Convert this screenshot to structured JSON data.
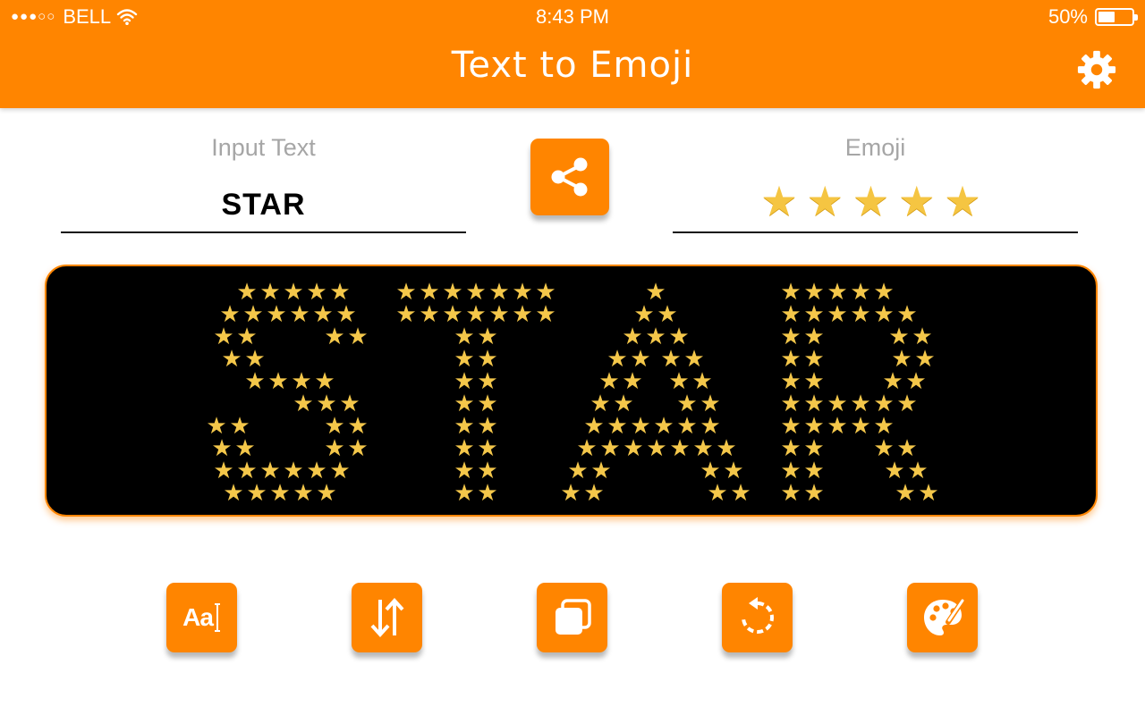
{
  "status_bar": {
    "signal_dots": "●●●○○",
    "carrier": "BELL",
    "time": "8:43 PM",
    "battery_percent": "50%",
    "battery_level": 0.5,
    "wifi_icon": "wifi-icon"
  },
  "header": {
    "title": "Text to Emoji",
    "settings_icon": "gear-icon"
  },
  "input": {
    "label": "Input Text",
    "value": "STAR"
  },
  "share_icon": "share-icon",
  "emoji": {
    "label": "Emoji",
    "value": "★★★★★"
  },
  "display": {
    "text": "STAR",
    "emoji": "★",
    "background": "#000000",
    "emoji_color": "#F4C74A"
  },
  "toolbar": [
    {
      "icon": "font-icon",
      "label": "Aa"
    },
    {
      "icon": "swap-vertical-icon"
    },
    {
      "icon": "copy-icon"
    },
    {
      "icon": "reset-icon"
    },
    {
      "icon": "palette-icon"
    }
  ],
  "colors": {
    "accent": "#FF8500",
    "label_gray": "#A6A6A6"
  }
}
